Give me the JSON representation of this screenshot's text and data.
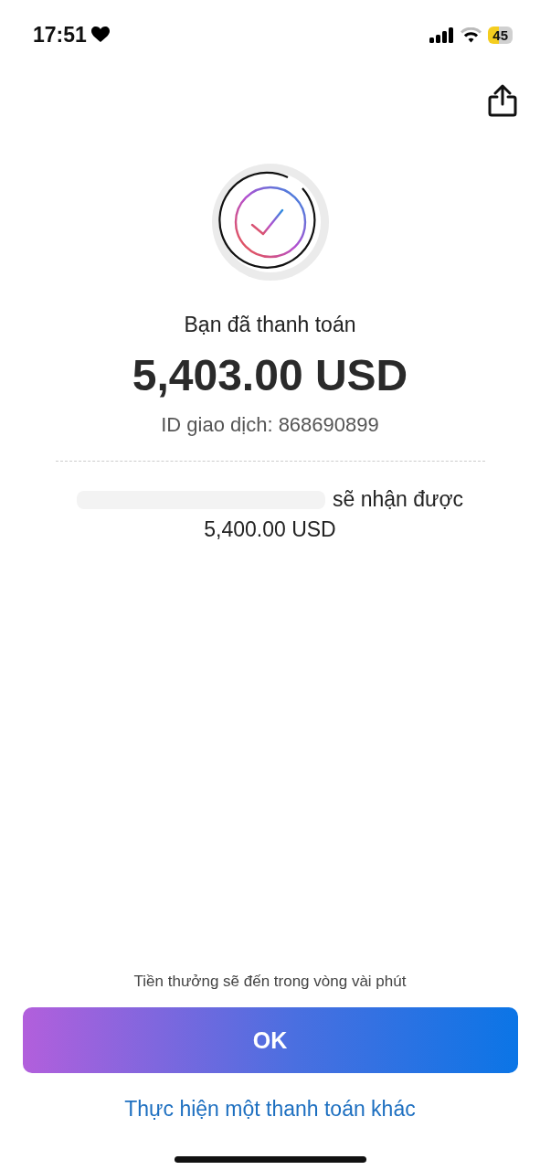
{
  "status_bar": {
    "time": "17:51",
    "battery": "45"
  },
  "payment": {
    "heading": "Bạn đã thanh toán",
    "amount": "5,403.00 USD",
    "transaction_id": "ID giao dịch: 868690899"
  },
  "recipient": {
    "redacted": true,
    "receives": "sẽ nhận được",
    "amount": "5,400.00 USD"
  },
  "note": "Tiền thưởng sẽ đến trong vòng vài phút",
  "ok_button": "OK",
  "another_payment_link": "Thực hiện một thanh toán khác"
}
